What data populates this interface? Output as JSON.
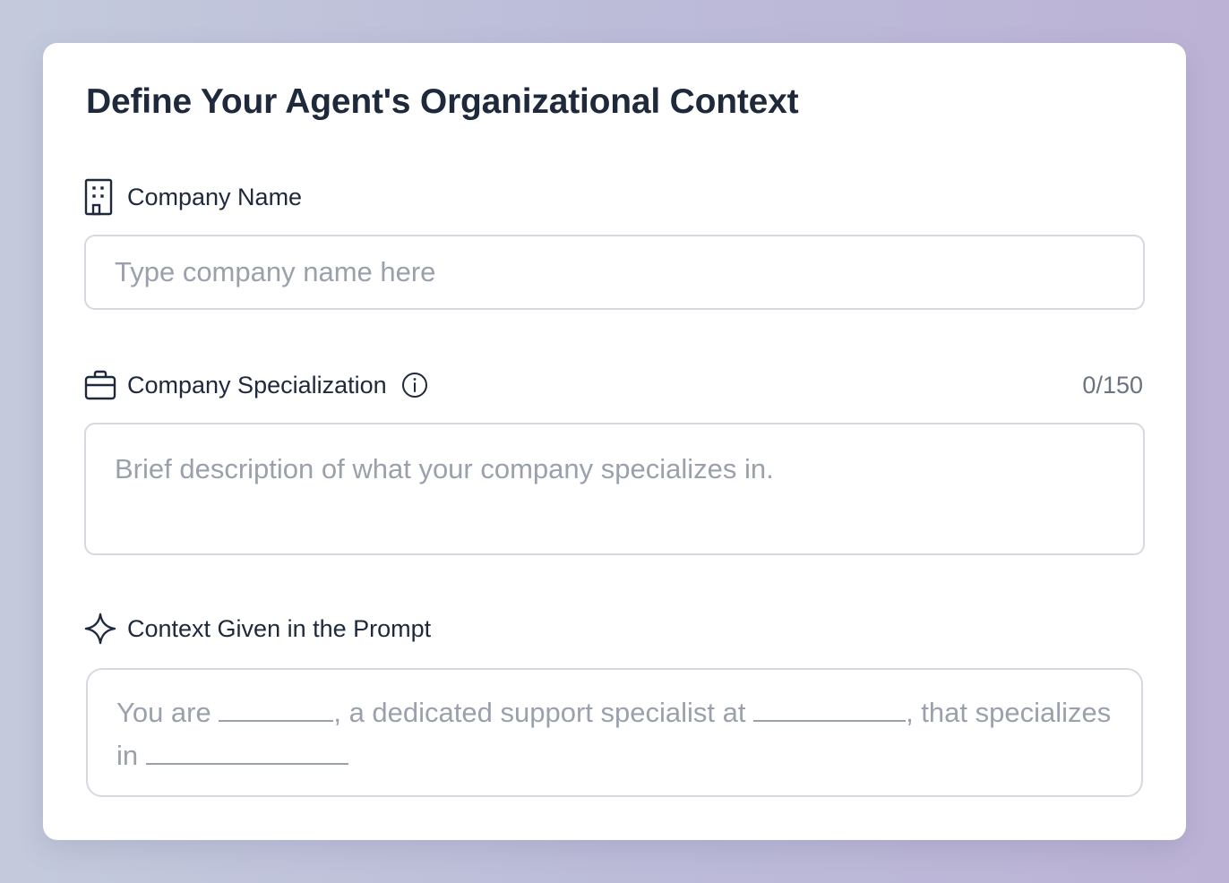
{
  "form": {
    "title": "Define Your Agent's Organizational Context",
    "company_name": {
      "label": "Company Name",
      "icon": "building-icon",
      "placeholder": "Type company name here",
      "value": ""
    },
    "company_specialization": {
      "label": "Company Specialization",
      "icon": "briefcase-icon",
      "info_icon": "info-icon",
      "counter": "0/150",
      "placeholder": "Brief description of what your company specializes in.",
      "value": ""
    },
    "prompt_context": {
      "label": "Context Given in the Prompt",
      "icon": "sparkle-icon",
      "segments": {
        "part1": "You are ",
        "part2": ", a dedicated support specialist at ",
        "part3": ", that specializes in "
      }
    }
  },
  "colors": {
    "text_primary": "#1e293b",
    "placeholder": "#9aa1ad",
    "border": "#d6d9e0",
    "background_gradient_start": "#c4cadc",
    "background_gradient_end": "#bcb2d6"
  }
}
